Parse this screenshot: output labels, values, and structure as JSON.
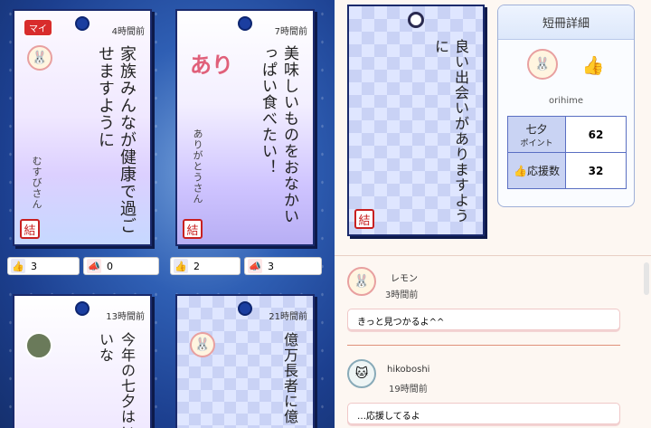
{
  "cards": [
    {
      "time": "4時間前",
      "badge": "マイ",
      "text": "家族みんなが健康で過ごせますように",
      "sign": "むすびさん",
      "likes": "3",
      "cheers": "0",
      "seal": "結"
    },
    {
      "time": "7時間前",
      "text": "美味しいものをおなかいっぱい食べたい！",
      "pink": "あり",
      "sign": "ありがとうさん",
      "likes": "2",
      "cheers": "3",
      "seal": "結"
    },
    {
      "time": "13時間前",
      "text": "今年の七夕はいいな"
    },
    {
      "time": "21時間前",
      "text": "億万長者に億"
    }
  ],
  "detail_card": {
    "text": "良い出会いがありますように",
    "seal": "結"
  },
  "panel": {
    "title": "短冊詳細",
    "user": "orihime",
    "points_label": "七夕",
    "points_sub": "ポイント",
    "points": "62",
    "cheer_label": "応援数",
    "cheers": "32"
  },
  "comments": [
    {
      "name": "レモン",
      "time": "3時間前",
      "text": "きっと見つかるよ^^"
    },
    {
      "name": "hikoboshi",
      "time": "19時間前",
      "text": "…応援してるよ"
    }
  ]
}
